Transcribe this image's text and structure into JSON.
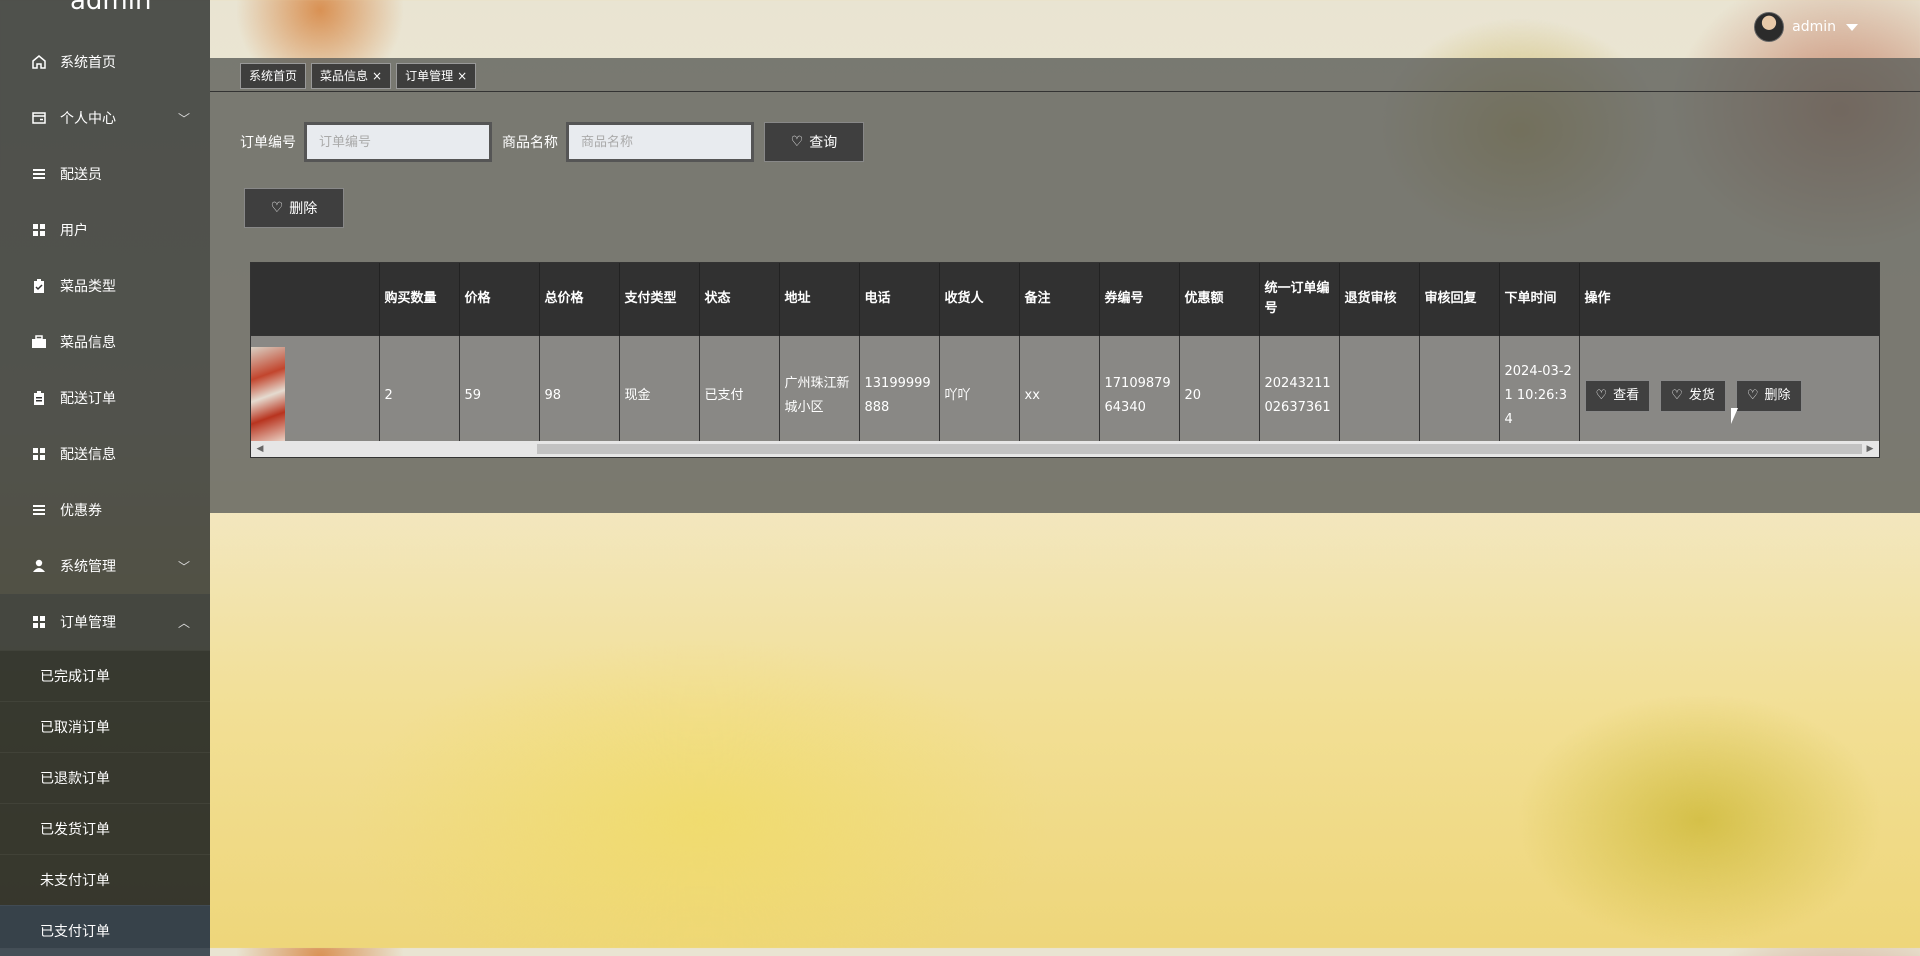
{
  "app": {
    "logo": "admin"
  },
  "user": {
    "name": "admin"
  },
  "sidebar": {
    "items": [
      {
        "label": "系统首页",
        "icon": "home-icon"
      },
      {
        "label": "个人中心",
        "icon": "wallet-icon",
        "chevron": "﹀"
      },
      {
        "label": "配送员",
        "icon": "list-icon"
      },
      {
        "label": "用户",
        "icon": "grid-icon"
      },
      {
        "label": "菜品类型",
        "icon": "clipboard-icon"
      },
      {
        "label": "菜品信息",
        "icon": "briefcase-icon"
      },
      {
        "label": "配送订单",
        "icon": "clipboard-icon"
      },
      {
        "label": "配送信息",
        "icon": "grid-icon"
      },
      {
        "label": "优惠券",
        "icon": "list-icon"
      },
      {
        "label": "系统管理",
        "icon": "person-icon",
        "chevron": "﹀"
      },
      {
        "label": "订单管理",
        "icon": "grid-icon",
        "chevron": "︿"
      }
    ],
    "sub_items": [
      "已完成订单",
      "已取消订单",
      "已退款订单",
      "已发货订单",
      "未支付订单",
      "已支付订单"
    ]
  },
  "tabs": [
    {
      "label": "系统首页",
      "closable": false
    },
    {
      "label": "菜品信息",
      "closable": true
    },
    {
      "label": "订单管理",
      "closable": true
    }
  ],
  "search": {
    "order_no_label": "订单编号",
    "order_no_placeholder": "订单编号",
    "product_label": "商品名称",
    "product_placeholder": "商品名称",
    "query_button": "查询",
    "delete_button": "删除"
  },
  "table": {
    "headers": [
      "",
      "购买数量",
      "价格",
      "总价格",
      "支付类型",
      "状态",
      "地址",
      "电话",
      "收货人",
      "备注",
      "券编号",
      "优惠额",
      "统一订单编号",
      "退货审核",
      "审核回复",
      "下单时间",
      "操作"
    ],
    "rows": [
      {
        "cells": [
          "",
          "2",
          "59",
          "98",
          "现金",
          "已支付",
          "广州珠江新城小区",
          "13199999888",
          "吖吖",
          "xx",
          "1710987964340",
          "20",
          "2024321102637361",
          "",
          "",
          "2024-03-21 10:26:34"
        ],
        "actions": [
          "查看",
          "发货",
          "删除"
        ]
      }
    ]
  },
  "colors": {
    "sidebar_bg": "#2c2f2e",
    "panel_bg": "#5f605c",
    "header_bg": "#2d2d2d",
    "active_sub": "#374450"
  }
}
